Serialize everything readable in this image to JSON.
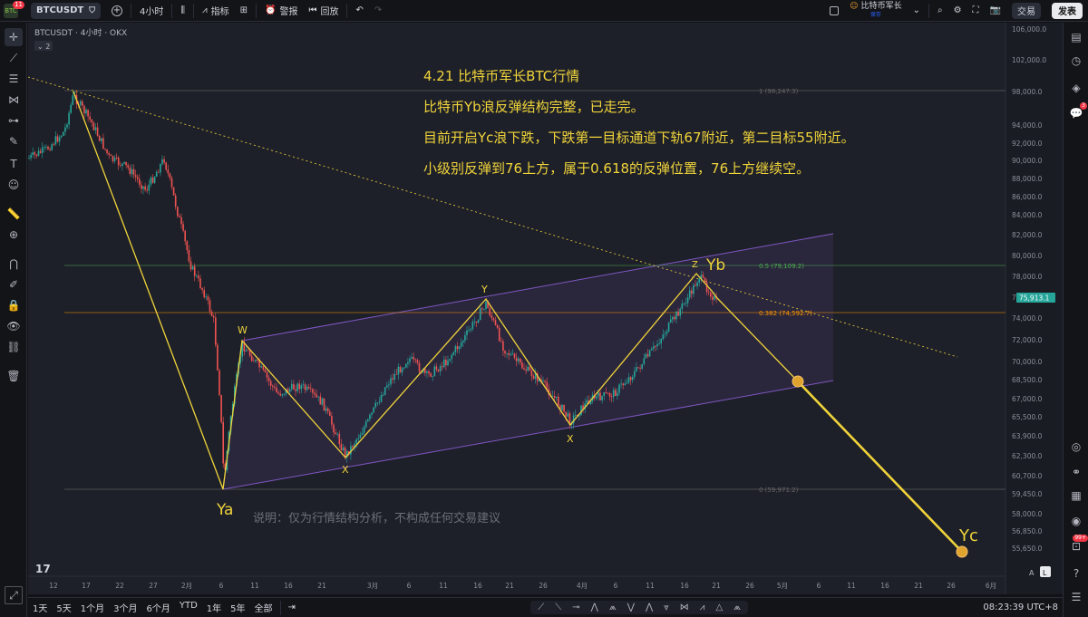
{
  "topbar": {
    "notif_badge": "11",
    "symbol": "BTCUSDT",
    "interval": "4小时",
    "indicators": "指标",
    "alert": "警报",
    "replay": "回放",
    "layout_name": "比特币军长",
    "save_status": "保存",
    "trade": "交易",
    "publish": "发表"
  },
  "legend": {
    "title": "BTCUSDT · 4小时 · OKX",
    "collapse": "2"
  },
  "annotation": {
    "line1": "4.21 比特币军长BTC行情",
    "line2": "比特币Yb浪反弹结构完整，已走完。",
    "line3": "目前开启Yc浪下跌，下跌第一目标通道下轨67附近，第二目标55附近。",
    "line4": "小级别反弹到76上方，属于0.618的反弹位置，76上方继续空。",
    "disclaimer": "说明：仅为行情结构分析，不构成任何交易建议"
  },
  "wave_labels": {
    "ya": "Ya",
    "w": "W",
    "x1": "X",
    "y": "Y",
    "x2": "X",
    "z": "Z",
    "yb": "Yb",
    "yc": "Yc"
  },
  "fib_labels": {
    "f1": "1 (98,247.3)",
    "f05": "0.5 (79,109.2)",
    "f0382": "0.382 (74,592.7)",
    "f0": "0 (59,971.2)"
  },
  "price_axis": [
    "106,000.0",
    "102,000.0",
    "98,000.0",
    "94,000.0",
    "92,000.0",
    "90,000.0",
    "88,000.0",
    "86,000.0",
    "84,000.0",
    "82,000.0",
    "80,000.0",
    "78,000.0",
    "76,000.0",
    "74,000.0",
    "72,000.0",
    "70,000.0",
    "68,500.0",
    "67,000.0",
    "65,500.0",
    "63,900.0",
    "62,300.0",
    "60,700.0",
    "59,450.0",
    "58,000.0",
    "56,850.0",
    "55,650.0"
  ],
  "current_price": "75,913.1",
  "time_axis": [
    "12",
    "17",
    "22",
    "27",
    "2月",
    "6",
    "11",
    "16",
    "21",
    "3月",
    "6",
    "11",
    "16",
    "21",
    "26",
    "4月",
    "6",
    "11",
    "16",
    "21",
    "26",
    "5月",
    "6",
    "11",
    "16",
    "21",
    "26",
    "6月"
  ],
  "axis_toggles": {
    "auto": "A",
    "log": "L"
  },
  "bottombar": {
    "ranges": [
      "1天",
      "5天",
      "1个月",
      "3个月",
      "6个月",
      "YTD",
      "1年",
      "5年",
      "全部"
    ],
    "time": "08:23:39 UTC+8"
  },
  "right_badges": {
    "chat": "3",
    "notif": "99+"
  },
  "colors": {
    "up": "#26a69a",
    "down": "#ef5350",
    "wave": "#f0d43a",
    "channel": "#7e57c2",
    "fib05": "#4caf50",
    "fib0382": "#ff9800",
    "text": "#f0d43a",
    "target": "#e0a32e"
  }
}
